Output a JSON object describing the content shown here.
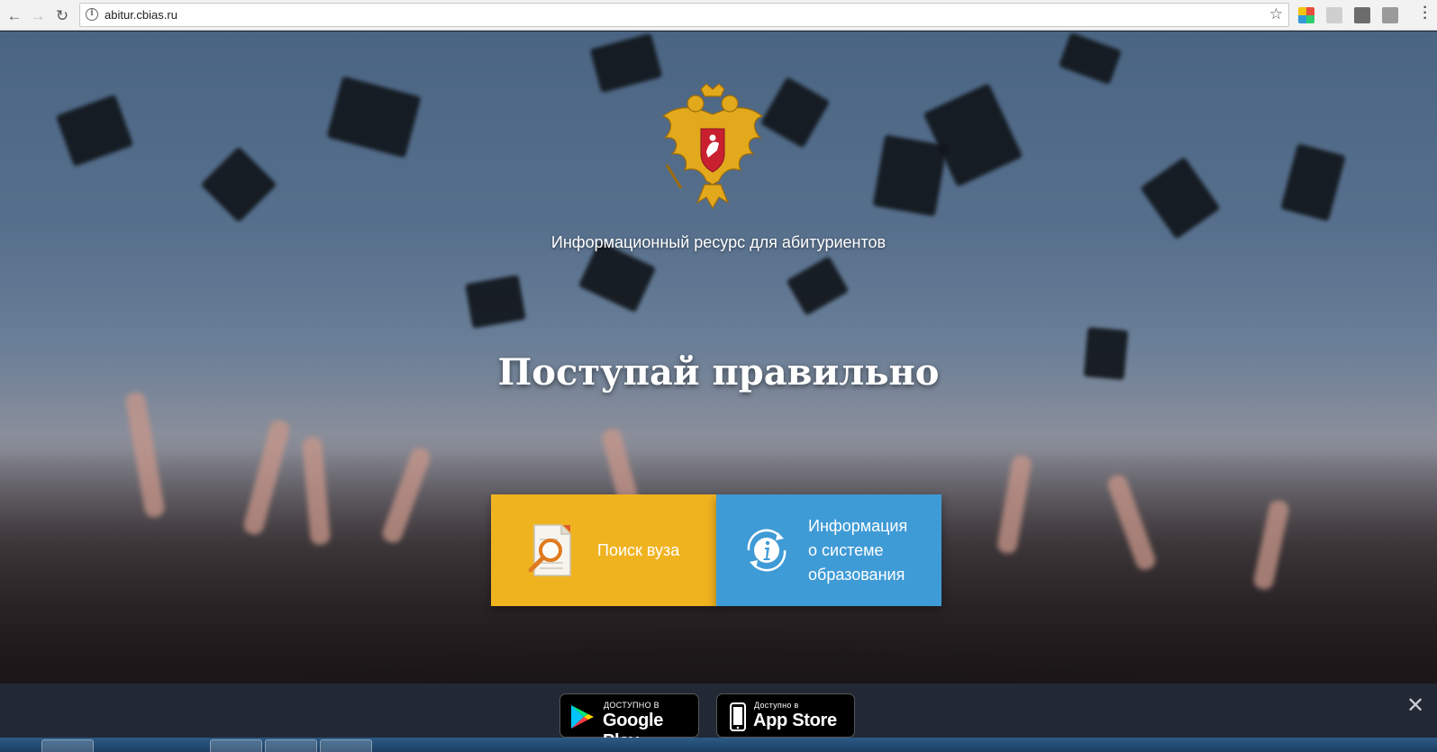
{
  "browser": {
    "url": "abitur.cbias.ru",
    "back_icon": "arrow-left-icon",
    "forward_icon": "arrow-right-icon",
    "reload_icon": "reload-icon",
    "bookmark_icon": "star-icon",
    "menu_icon": "kebab-menu-icon"
  },
  "hero": {
    "emblem": "russian-coat-of-arms",
    "subtitle": "Информационный ресурс для абитуриентов",
    "headline": "Поступай правильно"
  },
  "tiles": [
    {
      "label": "Поиск вуза",
      "icon": "document-search-icon",
      "color": "#f0b320"
    },
    {
      "label_lines": [
        "Информация",
        "о системе",
        "образования"
      ],
      "icon": "info-cycle-icon",
      "color": "#3f9bd6"
    }
  ],
  "app_banner": {
    "google_play": {
      "small": "ДОСТУПНО В",
      "big": "Google Play"
    },
    "app_store": {
      "small": "Доступно в",
      "big": "App Store"
    },
    "close_icon": "close-icon"
  },
  "colors": {
    "accent_yellow": "#f0b320",
    "accent_blue": "#3f9bd6",
    "banner_bg": "#222935"
  }
}
